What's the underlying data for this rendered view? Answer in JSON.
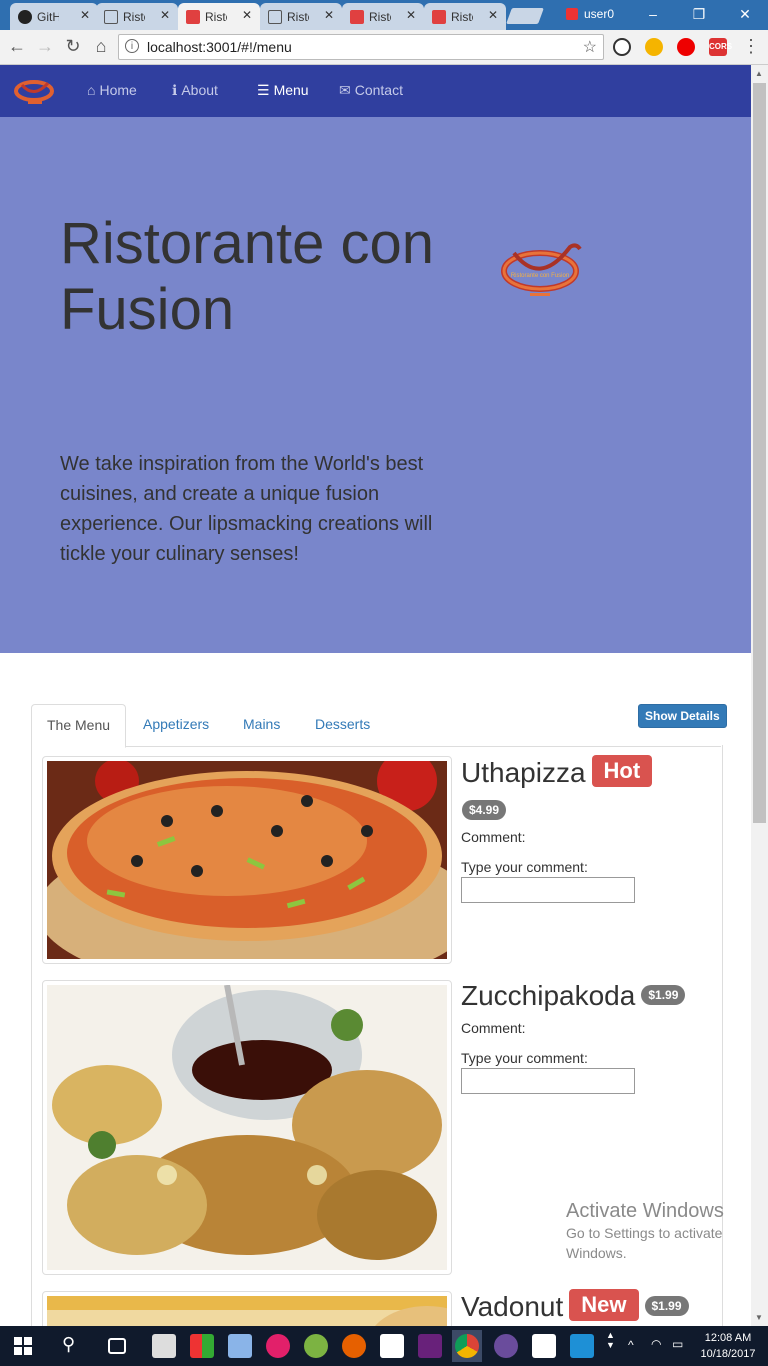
{
  "browser": {
    "tabs": [
      {
        "label": "GitH",
        "icon": "github-icon"
      },
      {
        "label": "Risto",
        "icon": "page-icon"
      },
      {
        "label": "Risto",
        "icon": "ristorante-icon",
        "active": true
      },
      {
        "label": "Risto",
        "icon": "document-icon"
      },
      {
        "label": "Risto",
        "icon": "ristorante-icon"
      },
      {
        "label": "Risto",
        "icon": "ristorante-icon"
      }
    ],
    "close_glyph": "✕",
    "user": "user0",
    "url": "localhost:3001/#!/menu",
    "ext_cors": "CORS"
  },
  "site": {
    "nav": [
      {
        "label": "Home",
        "icon": "home-icon",
        "glyph": "⌂"
      },
      {
        "label": "About",
        "icon": "info-icon",
        "glyph": "ℹ"
      },
      {
        "label": "Menu",
        "icon": "list-icon",
        "glyph": "☰",
        "active": true
      },
      {
        "label": "Contact",
        "icon": "envelope-icon",
        "glyph": "✉"
      }
    ],
    "logo_text": "Ristorante con Fusion",
    "jumbotron": {
      "title": "Ristorante con Fusion",
      "text": "We take inspiration from the World's best cuisines, and create a unique fusion experience. Our lipsmacking creations will tickle your culinary senses!"
    },
    "menu_tabs": [
      "The Menu",
      "Appetizers",
      "Mains",
      "Desserts"
    ],
    "show_details": "Show Details",
    "dishes": [
      {
        "name": "Uthapizza",
        "label": "Hot",
        "price": "$4.99",
        "comment": "Comment:",
        "prompt": "Type your comment:"
      },
      {
        "name": "Zucchipakoda",
        "label": "",
        "price": "$1.99",
        "comment": "Comment:",
        "prompt": "Type your comment:"
      },
      {
        "name": "Vadonut",
        "label": "New",
        "price": "$1.99"
      }
    ],
    "accent": "#303f9f",
    "jumbotron_color": "#7986cb",
    "label_color": "#d9534f"
  },
  "watermark": {
    "line1": "Activate Windows",
    "line2": "Go to Settings to activate Windows."
  },
  "taskbar": {
    "time": "12:08 AM",
    "date": "10/18/2017"
  }
}
